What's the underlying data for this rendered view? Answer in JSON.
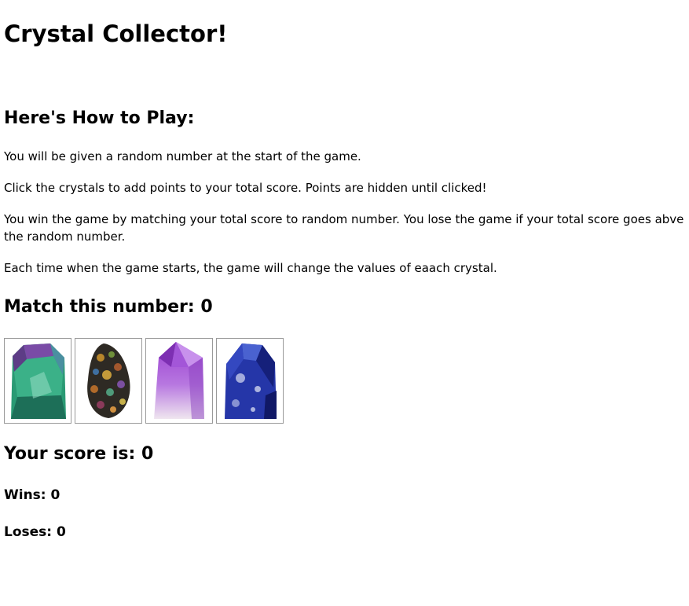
{
  "page": {
    "title": "Crystal Collector!"
  },
  "instructions": {
    "heading": "Here's How to Play:",
    "rules": [
      "You will be given a random number at the start of the game.",
      "Click the crystals to add points to your total score. Points are hidden until clicked!",
      "You win the game by matching your total score to random number. You lose the game if your total score goes abve the random number.",
      "Each time when the game starts, the game will change the values of eaach crystal."
    ]
  },
  "target": {
    "label": "Match this number: ",
    "value": "0"
  },
  "crystals": [
    {
      "name": "green-fluorite-crystal",
      "colors": [
        "#1f8f6e",
        "#6a3f8f",
        "#2fa77f"
      ]
    },
    {
      "name": "rainbow-cluster-crystal",
      "colors": [
        "#2b2b2b",
        "#8a5a1e",
        "#5b7d3a"
      ]
    },
    {
      "name": "amethyst-crystal",
      "colors": [
        "#8e3cc4",
        "#c48ee6",
        "#ece3ef"
      ]
    },
    {
      "name": "sodalite-crystal",
      "colors": [
        "#1f2f9e",
        "#3a4fc8",
        "#0e1660"
      ]
    }
  ],
  "score": {
    "label": "Your score is: ",
    "value": "0"
  },
  "stats": {
    "wins_label": "Wins: ",
    "wins": "0",
    "loses_label": "Loses: ",
    "loses": "0"
  }
}
